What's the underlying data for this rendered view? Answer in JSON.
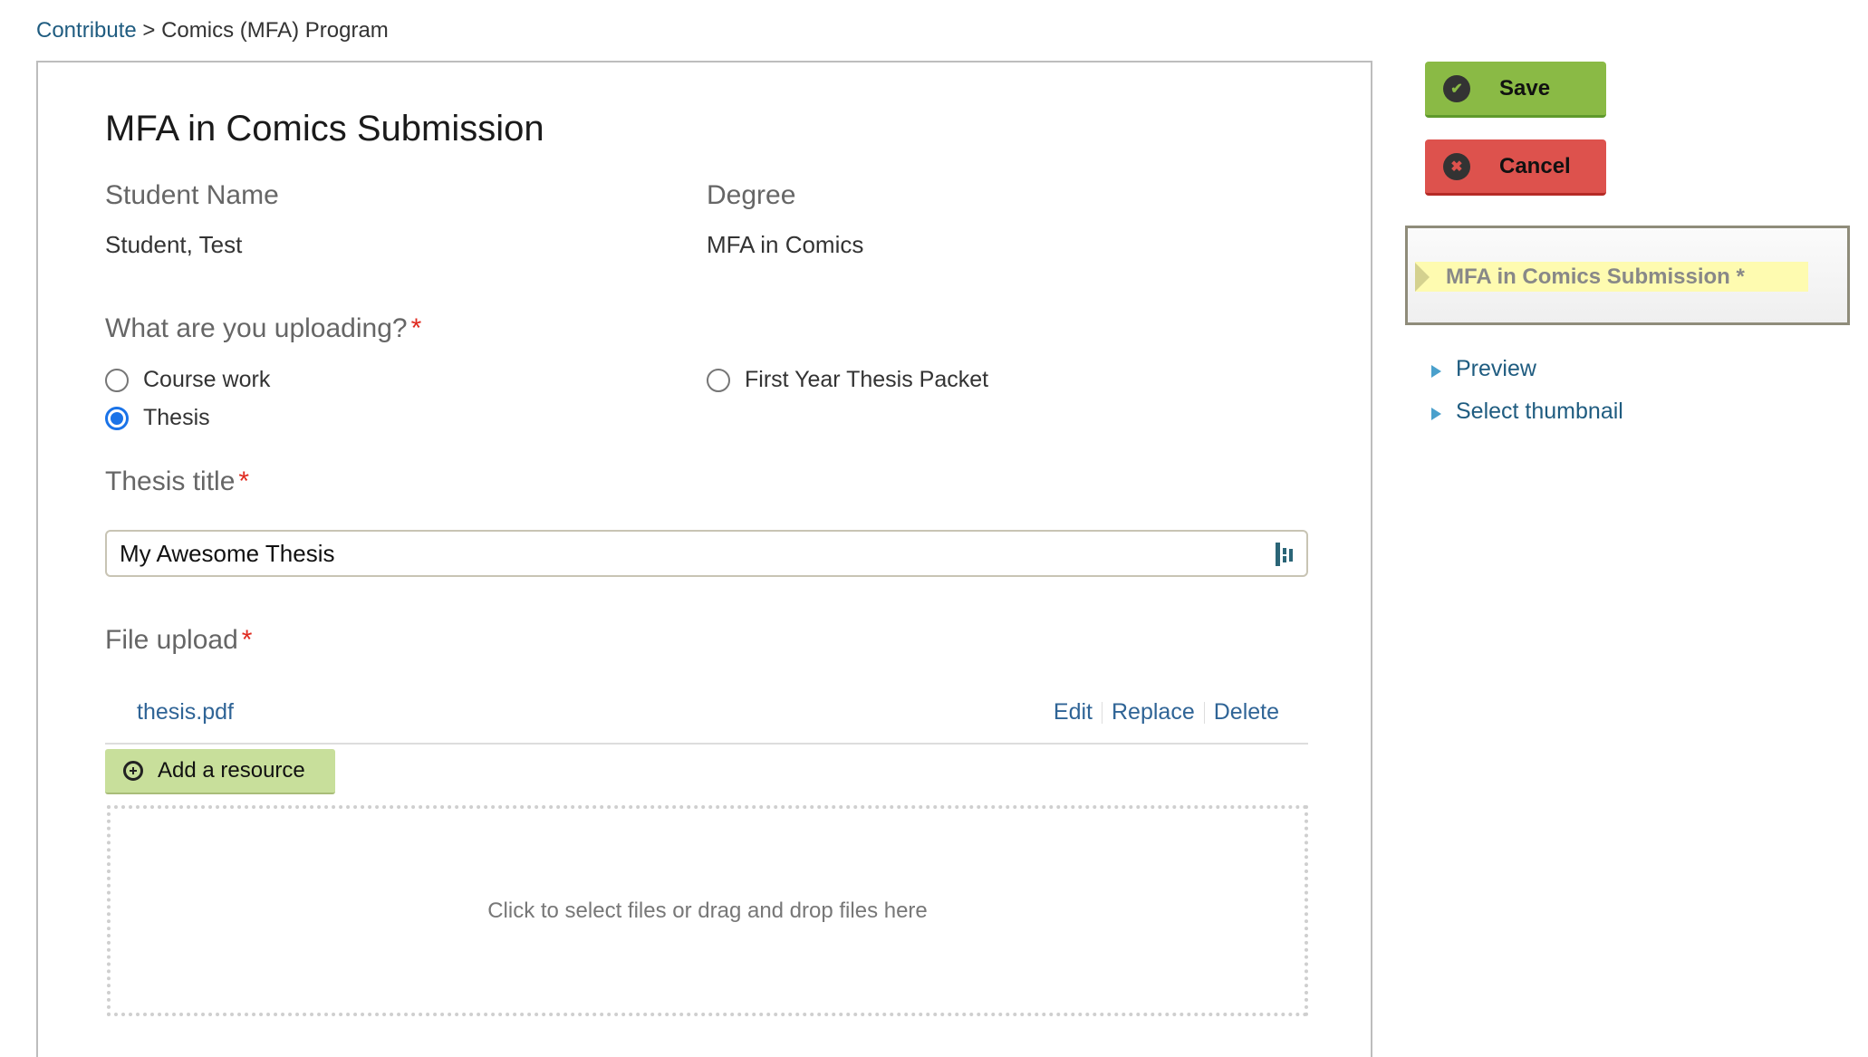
{
  "breadcrumb": {
    "root": "Contribute",
    "separator": ">",
    "current": "Comics (MFA) Program"
  },
  "form": {
    "title": "MFA in Comics Submission",
    "student_name": {
      "label": "Student Name",
      "value": "Student, Test"
    },
    "degree": {
      "label": "Degree",
      "value": "MFA in Comics"
    },
    "upload_type": {
      "label": "What are you uploading?",
      "required_mark": "*",
      "options": [
        {
          "label": "Course work",
          "checked": false
        },
        {
          "label": "Thesis",
          "checked": true
        },
        {
          "label": "First Year Thesis Packet",
          "checked": false
        }
      ]
    },
    "thesis_title": {
      "label": "Thesis title",
      "required_mark": "*",
      "value": "My Awesome Thesis",
      "autofill_icon": "dashlane-icon"
    },
    "file_upload": {
      "label": "File upload",
      "required_mark": "*",
      "files": [
        {
          "name": "thesis.pdf",
          "actions": [
            "Edit",
            "Replace",
            "Delete"
          ]
        }
      ],
      "add_resource_label": "Add a resource",
      "dropzone_text": "Click to select files or drag and drop files here"
    }
  },
  "actions": {
    "save_label": "Save",
    "cancel_label": "Cancel",
    "save_color": "#8aba45",
    "cancel_color": "#dd524d"
  },
  "sidebar": {
    "current_step": "MFA in Comics Submission *",
    "links": [
      {
        "label": "Preview"
      },
      {
        "label": "Select thumbnail"
      }
    ]
  }
}
